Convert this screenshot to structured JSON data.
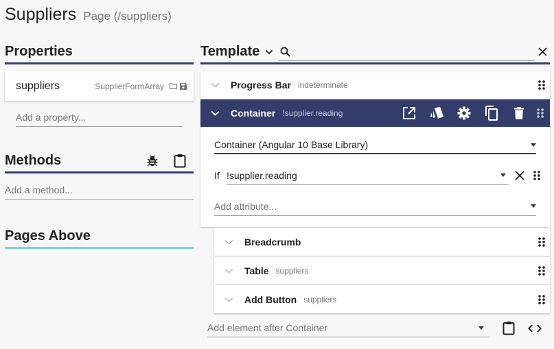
{
  "header": {
    "title": "Suppliers",
    "subtitle": "Page (/suppliers)"
  },
  "properties": {
    "heading": "Properties",
    "items": [
      {
        "name": "suppliers",
        "type": "SupplierFormArray",
        "icons": [
          "folder-icon",
          "save-icon"
        ]
      }
    ],
    "add_placeholder": "Add a property..."
  },
  "methods": {
    "heading": "Methods",
    "icons": [
      "bug-icon",
      "clipboard-icon"
    ],
    "add_placeholder": "Add a method..."
  },
  "pages_above": {
    "heading": "Pages Above"
  },
  "template": {
    "heading": "Template",
    "search_value": "",
    "nodes": [
      {
        "label": "Progress Bar",
        "sub": "indeterminate",
        "expanded": false
      },
      {
        "label": "Container",
        "sub": "!supplier.reading",
        "expanded": true,
        "toolbar": [
          "open-in-new-icon",
          "style-icon",
          "gear-icon",
          "copy-icon",
          "trash-icon",
          "drag-handle-icon"
        ]
      }
    ],
    "container_detail": {
      "component_select": "Container (Angular 10 Base Library)",
      "if_label": "If",
      "if_value": "!supplier.reading",
      "add_attribute_placeholder": "Add attribute..."
    },
    "children": [
      {
        "label": "Breadcrumb",
        "sub": ""
      },
      {
        "label": "Table",
        "sub": "suppliers"
      },
      {
        "label": "Add Button",
        "sub": "suppliers"
      }
    ],
    "add_element_placeholder": "Add element after Container"
  },
  "colors": {
    "accent": "#343c6b",
    "accent_light": "#7fcdf1",
    "background": "#f7f7f7"
  }
}
